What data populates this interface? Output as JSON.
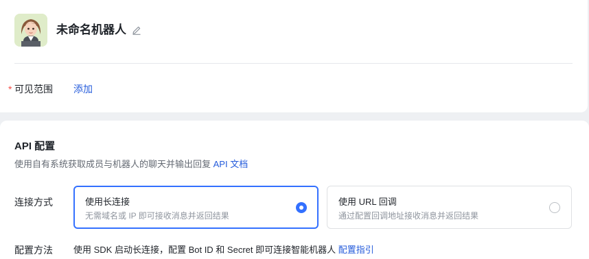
{
  "bot": {
    "name": "未命名机器人",
    "avatar_icon": "female-avatar-illustration",
    "edit_icon": "pencil-icon"
  },
  "visibility": {
    "required_mark": "*",
    "label": "可见范围",
    "add_link": "添加"
  },
  "api": {
    "title": "API 配置",
    "description": "使用自有系统获取成员与机器人的聊天并输出回复",
    "doc_link": "API 文档"
  },
  "connection": {
    "label": "连接方式",
    "options": [
      {
        "title": "使用长连接",
        "subtitle": "无需域名或 IP 即可接收消息并返回结果",
        "selected": true
      },
      {
        "title": "使用 URL 回调",
        "subtitle": "通过配置回调地址接收消息并返回结果",
        "selected": false
      }
    ]
  },
  "config_method": {
    "label": "配置方法",
    "text": "使用 SDK 启动长连接，配置 Bot ID 和 Secret 即可连接智能机器人",
    "link": "配置指引"
  },
  "colors": {
    "accent": "#3370ff",
    "link": "#245bdb",
    "required": "#f54a45",
    "page_bg": "#eef0f3"
  }
}
